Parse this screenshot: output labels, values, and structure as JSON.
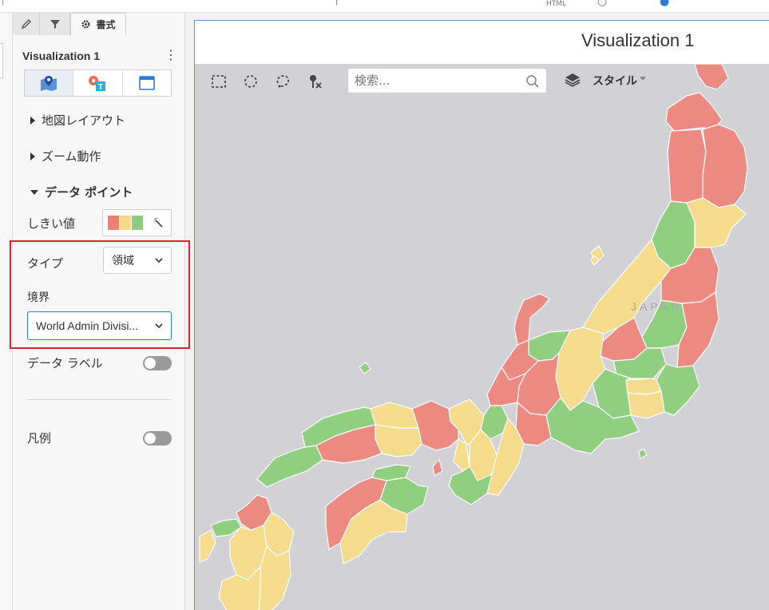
{
  "topbar": {
    "html_text": "HTML"
  },
  "panel": {
    "tabs": [
      {
        "name": "edit",
        "icon": "pencil-icon"
      },
      {
        "name": "filter",
        "icon": "filter-icon"
      },
      {
        "name": "format",
        "icon": "gear-icon",
        "label": "書式"
      }
    ],
    "viz_title": "Visualization 1",
    "more_label": "⋮",
    "view_buttons": [
      {
        "icon": "map-pin-icon",
        "selected": true
      },
      {
        "icon": "map-text-icon",
        "selected": false
      },
      {
        "icon": "card-icon",
        "selected": false
      }
    ],
    "sections": {
      "map_layout": "地図レイアウト",
      "zoom_behavior": "ズーム動作",
      "data_points": "データ ポイント"
    },
    "threshold_label": "しきい値",
    "threshold_colors": [
      "#ee7f73",
      "#f7d98a",
      "#8fcc7c"
    ],
    "type_label": "タイプ",
    "type_value": "領域",
    "boundary_label": "境界",
    "boundary_value": "World Admin Divisi...",
    "data_label_label": "データ ラベル",
    "legend_label": "凡例",
    "data_label_on": false,
    "legend_on": false
  },
  "viz": {
    "title": "Visualization 1",
    "search_placeholder": "検索...",
    "style_label": "スタイル",
    "map_label": "JAPAN",
    "colors": {
      "red": "#ec8a82",
      "yellow": "#f5db8c",
      "green": "#90cf80",
      "sea": "#d2d1d6",
      "border": "#ffffff"
    }
  }
}
